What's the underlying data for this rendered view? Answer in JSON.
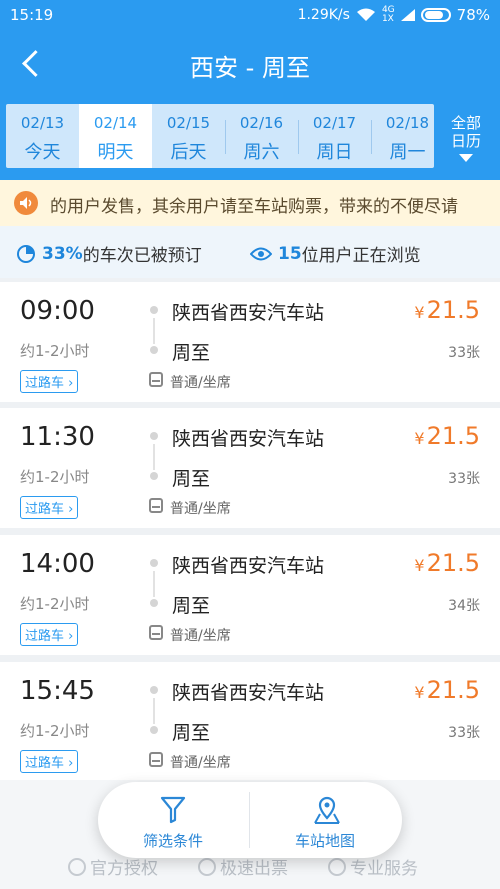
{
  "status_bar": {
    "time": "15:19",
    "network_speed": "1.29K/s",
    "signal_top": "4G",
    "signal_bottom": "1X",
    "battery": "78%"
  },
  "header": {
    "title": "西安 - 周至"
  },
  "dates": [
    {
      "date": "02/13",
      "day": "今天",
      "active": false
    },
    {
      "date": "02/14",
      "day": "明天",
      "active": true
    },
    {
      "date": "02/15",
      "day": "后天",
      "active": false
    },
    {
      "date": "02/16",
      "day": "周六",
      "active": false
    },
    {
      "date": "02/17",
      "day": "周日",
      "active": false
    },
    {
      "date": "02/18",
      "day": "周一",
      "active": false
    }
  ],
  "calendar_button": {
    "line1": "全部",
    "line2": "日历"
  },
  "notice": {
    "text": "的用户发售，其余用户请至车站购票，带来的不便尽请"
  },
  "stats": {
    "booked_percent": "33%",
    "booked_text": "的车次已被预订",
    "viewers": "15",
    "viewers_text": "位用户正在浏览"
  },
  "trips": [
    {
      "time": "09:00",
      "duration": "约1-2小时",
      "tag": "过路车",
      "from": "陕西省西安汽车站",
      "to": "周至",
      "seat": "普通/坐席",
      "price": "21.5",
      "currency": "¥",
      "tickets": "33张"
    },
    {
      "time": "11:30",
      "duration": "约1-2小时",
      "tag": "过路车",
      "from": "陕西省西安汽车站",
      "to": "周至",
      "seat": "普通/坐席",
      "price": "21.5",
      "currency": "¥",
      "tickets": "33张"
    },
    {
      "time": "14:00",
      "duration": "约1-2小时",
      "tag": "过路车",
      "from": "陕西省西安汽车站",
      "to": "周至",
      "seat": "普通/坐席",
      "price": "21.5",
      "currency": "¥",
      "tickets": "34张"
    },
    {
      "time": "15:45",
      "duration": "约1-2小时",
      "tag": "过路车",
      "from": "陕西省西安汽车站",
      "to": "周至",
      "seat": "普通/坐席",
      "price": "21.5",
      "currency": "¥",
      "tickets": "33张"
    }
  ],
  "bottom_actions": {
    "filter": "筛选条件",
    "map": "车站地图"
  },
  "footer_badges": [
    "官方授权",
    "极速出票",
    "专业服务"
  ],
  "colors": {
    "primary": "#2b9bf0",
    "price": "#f07a2a",
    "notice_bg": "#fff6dd"
  }
}
